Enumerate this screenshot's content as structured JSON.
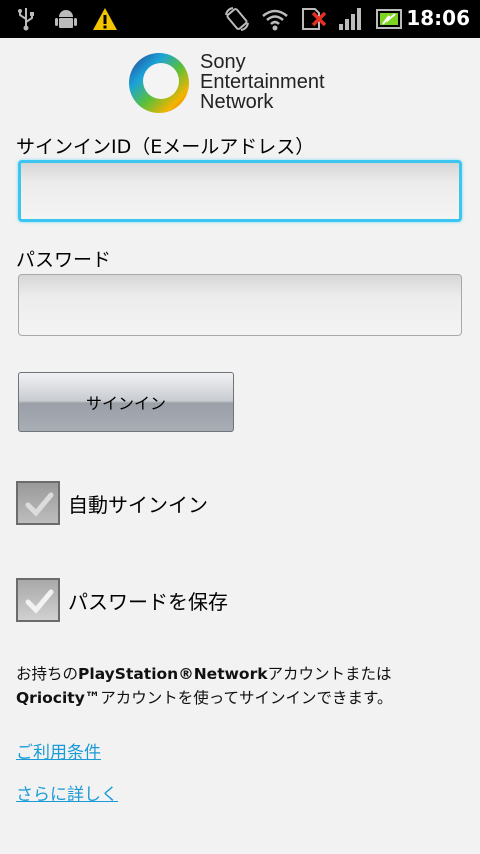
{
  "status_bar": {
    "icons_left": [
      "usb-icon",
      "android-debug-icon",
      "warning-icon"
    ],
    "icons_right": [
      "rotate-icon",
      "wifi-icon",
      "no-sim-icon",
      "signal-icon",
      "battery-icon"
    ],
    "time": "18:06"
  },
  "logo": {
    "lines": [
      "Sony",
      "Entertainment",
      "Network"
    ]
  },
  "form": {
    "signin_id_label": "サインインID（Eメールアドレス）",
    "signin_id_value": "",
    "password_label": "パスワード",
    "password_value": "",
    "signin_button": "サインイン",
    "auto_signin_label": "自動サインイン",
    "auto_signin_checked": true,
    "save_password_label": "パスワードを保存",
    "save_password_checked": true
  },
  "note": {
    "line1_prefix": "お持ちの",
    "line1_bold": "PlayStation®Network",
    "line1_suffix": "アカウントまたは",
    "line2_bold": "Qriocity™",
    "line2_suffix": "アカウントを使ってサインインできます。"
  },
  "links": {
    "terms": "ご利用条件",
    "more": "さらに詳しく"
  },
  "colors": {
    "accent": "#3cc6ef",
    "link": "#1a9bd7",
    "background": "#f2f2f2"
  }
}
